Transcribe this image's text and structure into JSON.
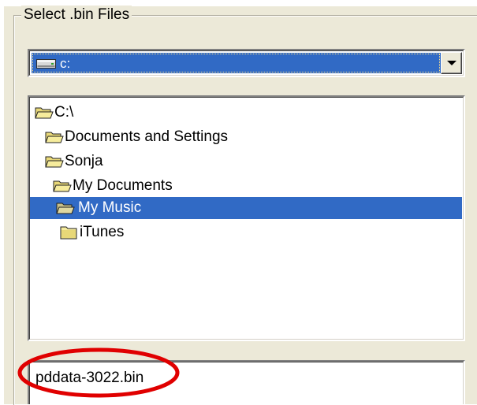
{
  "dialog": {
    "group_label": "Select .bin Files"
  },
  "drive_select": {
    "value": "c:",
    "icon": "drive-icon"
  },
  "folder_tree": {
    "items": [
      {
        "label": "C:\\",
        "icon": "open-folder-icon",
        "selected": false
      },
      {
        "label": "Documents and Settings",
        "icon": "open-folder-icon",
        "selected": false
      },
      {
        "label": "Sonja",
        "icon": "open-folder-icon",
        "selected": false
      },
      {
        "label": "My Documents",
        "icon": "open-folder-icon",
        "selected": false
      },
      {
        "label": "My Music",
        "icon": "open-folder-icon",
        "selected": true
      },
      {
        "label": "iTunes",
        "icon": "closed-folder-icon",
        "selected": false
      }
    ]
  },
  "file_list": {
    "items": [
      {
        "name": "pddata-3022.bin"
      }
    ]
  },
  "colors": {
    "selection": "#316ac5",
    "panel": "#ece9d8",
    "annotation": "#e00000"
  }
}
